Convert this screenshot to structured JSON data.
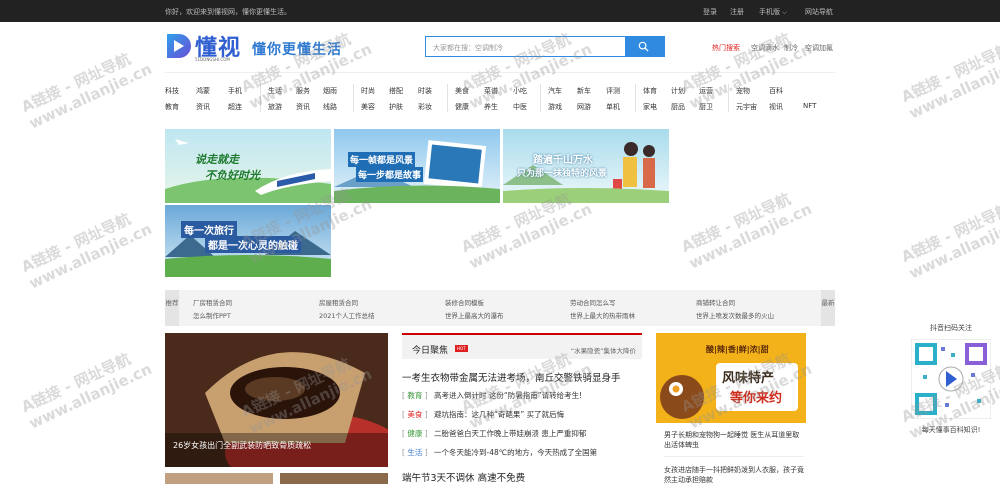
{
  "topbar": {
    "welcome": "你好，欢迎来到懂视网，懂你更懂生活。",
    "login": "登录",
    "register": "注册",
    "mobile": "手机版",
    "sitenav": "网站导航"
  },
  "logo": {
    "name": "懂视",
    "domain": "51DONGSHI.COM",
    "slogan": "懂你更懂生活"
  },
  "search": {
    "placeholder": "大家都在搜：空调制冷"
  },
  "hot_searches": [
    {
      "label": "热门搜索",
      "color": "#e02020"
    },
    {
      "label": "空调滴水",
      "color": "#666666"
    },
    {
      "label": "制冷",
      "color": "#666666"
    },
    {
      "label": "空调加氟",
      "color": "#666666"
    }
  ],
  "nav": [
    {
      "row1": [
        "科技",
        "鸿蒙",
        "手机"
      ],
      "row2": [
        "教育",
        "资讯",
        "超连"
      ]
    },
    {
      "row1": [
        "生活",
        "服务",
        "烟雨"
      ],
      "row2": [
        "旅游",
        "资讯",
        "线路"
      ]
    },
    {
      "row1": [
        "时尚",
        "搭配",
        "时装"
      ],
      "row2": [
        "美容",
        "护肤",
        "彩妆"
      ]
    },
    {
      "row1": [
        "美食",
        "菜谱",
        "小吃"
      ],
      "row2": [
        "健康",
        "养生",
        "中医"
      ]
    },
    {
      "row1": [
        "汽车",
        "新车",
        "评测"
      ],
      "row2": [
        "游戏",
        "网游",
        "单机"
      ]
    },
    {
      "row1": [
        "体育",
        "计划",
        "运营"
      ],
      "row2": [
        "家电",
        "厨品",
        "厨卫"
      ]
    },
    {
      "row1": [
        "宠物",
        "百科"
      ],
      "row2": [
        "元宇宙",
        "视讯",
        "NFT"
      ]
    }
  ],
  "banners": [
    {
      "line1": "说走就走",
      "line2": "不负好时光"
    },
    {
      "line1": "每一帧都是风景",
      "line2": "每一步都是故事"
    },
    {
      "line1": "踏遍千山万水",
      "line2": "只为那一抹独特的风景"
    },
    {
      "line1": "每一次旅行",
      "line2": "都是一次心灵的触碰"
    }
  ],
  "newsbar": {
    "left_label": "推荐",
    "right_label": "最新",
    "row1": [
      "厂房租赁合同",
      "房屋租赁合同",
      "装修合同模板",
      "劳动合同怎么写",
      "商铺转让合同"
    ],
    "row2": [
      "怎么制作PPT",
      "2021个人工作总结",
      "世界上最高大的瀑布",
      "世界上最大的热带雨林",
      "世界上喷发次数最多的火山"
    ]
  },
  "slider": {
    "caption": "26岁女孩出门全副武装防晒致骨质疏松"
  },
  "focus": {
    "title": "今日聚焦",
    "hot_badge": "HOT",
    "right_text": "“水果隐瓷”集体大降价",
    "headline": "一考生衣物带金属无法进考场，南丘交警铁骑显身手",
    "items": [
      {
        "tag": "教育",
        "color": "#3a9a3a",
        "text": "高考进入倒计时 这份“防暑指南”请转给考生!"
      },
      {
        "tag": "美食",
        "color": "#e02020",
        "text": "避坑指南：这几种“奇葩果” 买了就后悔"
      },
      {
        "tag": "健康",
        "color": "#3a9a3a",
        "text": "二胎爸爸白天工作晚上带娃崩溃 患上严重抑郁"
      },
      {
        "tag": "生活",
        "color": "#3a7ad0",
        "text": "一个冬天能冷到-48℃的地方，今天热成了全国第"
      }
    ],
    "headline2": "端午节3天不调休 高速不免费"
  },
  "ad": {
    "top": "酸|辣|香|鲜|浓|甜",
    "line1": "风味特产",
    "line2": "等你来约"
  },
  "right_news": [
    "男子长期和宠物狗一起睡觉 医生从耳道里取出活体蜱虫",
    "女孩进店随手一抖把鲜奶泼到人衣服，孩子竟然主动承担赔款"
  ],
  "qr": {
    "title": "抖音扫码关注",
    "caption": "每天懂事百科知识!"
  },
  "watermarks": [
    "A链接 - 网址导航",
    "www.allanjie.cn"
  ],
  "colors": {
    "brand": "#2f5fd0",
    "accent": "#2f8ae0",
    "hot": "#e02020"
  }
}
